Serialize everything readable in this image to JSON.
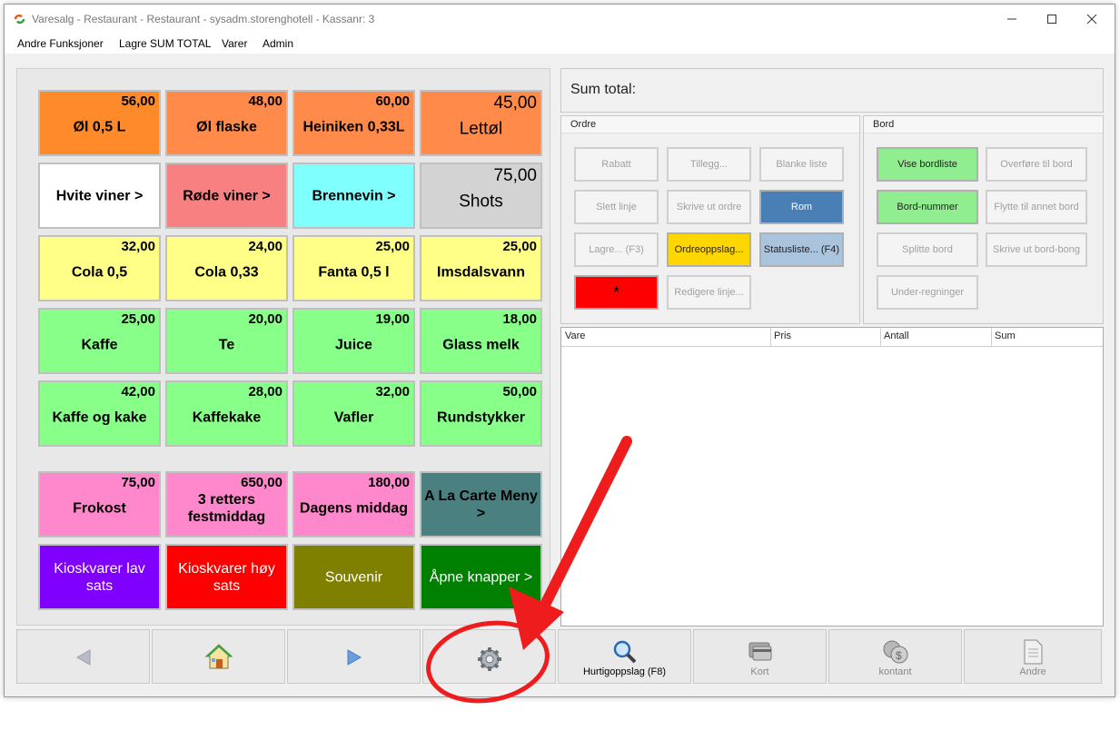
{
  "window": {
    "title": "Varesalg - Restaurant - Restaurant - sysadm.storenghotell -  Kassanr: 3"
  },
  "menu": [
    "Andre Funksjoner",
    "Lagre SUM TOTAL",
    "Varer",
    "Admin"
  ],
  "products": [
    {
      "name": "Øl 0,5 L",
      "price": "56,00",
      "bg": "#ff8a2a"
    },
    {
      "name": "Øl flaske",
      "price": "48,00",
      "bg": "#ff8a4a"
    },
    {
      "name": "Heiniken 0,33L",
      "price": "60,00",
      "bg": "#ff8a4a"
    },
    {
      "name": "Lettøl",
      "price": "45,00",
      "bg": "#ff8a4a"
    },
    {
      "name": "Hvite viner >",
      "price": "",
      "bg": "#ffffff"
    },
    {
      "name": "Røde viner >",
      "price": "",
      "bg": "#f98080"
    },
    {
      "name": "Brennevin >",
      "price": "",
      "bg": "#80ffff"
    },
    {
      "name": "Shots",
      "price": "75,00",
      "bg": "#d3d3d3"
    },
    {
      "name": "Cola 0,5",
      "price": "32,00",
      "bg": "#ffff88"
    },
    {
      "name": "Cola 0,33",
      "price": "24,00",
      "bg": "#ffff88"
    },
    {
      "name": "Fanta 0,5 l",
      "price": "25,00",
      "bg": "#ffff88"
    },
    {
      "name": "Imsdalsvann",
      "price": "25,00",
      "bg": "#ffff88"
    },
    {
      "name": "Kaffe",
      "price": "25,00",
      "bg": "#88ff88"
    },
    {
      "name": "Te",
      "price": "20,00",
      "bg": "#88ff88"
    },
    {
      "name": "Juice",
      "price": "19,00",
      "bg": "#88ff88"
    },
    {
      "name": "Glass melk",
      "price": "18,00",
      "bg": "#88ff88"
    },
    {
      "name": "Kaffe og kake",
      "price": "42,00",
      "bg": "#88ff88"
    },
    {
      "name": "Kaffekake",
      "price": "28,00",
      "bg": "#88ff88"
    },
    {
      "name": "Vafler",
      "price": "32,00",
      "bg": "#88ff88"
    },
    {
      "name": "Rundstykker",
      "price": "50,00",
      "bg": "#88ff88"
    },
    {
      "name": "Frokost",
      "price": "75,00",
      "bg": "#ff88cc"
    },
    {
      "name": "3 retters festmiddag",
      "price": "650,00",
      "bg": "#ff88cc"
    },
    {
      "name": "Dagens middag",
      "price": "180,00",
      "bg": "#ff88cc"
    },
    {
      "name": "A La Carte Meny >",
      "price": "",
      "bg": "#4a8080"
    },
    {
      "name": "Kioskvarer lav sats",
      "price": "",
      "bg": "#8000ff"
    },
    {
      "name": "Kioskvarer høy sats",
      "price": "",
      "bg": "#ff0000"
    },
    {
      "name": "Souvenir",
      "price": "",
      "bg": "#808000"
    },
    {
      "name": "Åpne knapper >",
      "price": "",
      "bg": "#008000"
    }
  ],
  "sum": {
    "label": "Sum total:"
  },
  "ordre": {
    "label": "Ordre",
    "buttons": [
      "Rabatt",
      "Tillegg...",
      "Blanke liste",
      "Slett linje",
      "Skrive ut ordre",
      "Rom",
      "Lagre... (F3)",
      "Ordreoppslag...",
      "Statusliste... (F4)",
      "*",
      "Redigere linje..."
    ]
  },
  "bord": {
    "label": "Bord",
    "buttons": [
      "Vise bordliste",
      "Overføre til bord",
      "Bord-nummer",
      "Flytte til annet bord",
      "Splitte bord",
      "Skrive ut bord-bong",
      "Under-regninger"
    ]
  },
  "grid": {
    "columns": [
      "Vare",
      "Pris",
      "Antall",
      "Sum"
    ]
  },
  "bottom": {
    "buttons": [
      "",
      "",
      "",
      "",
      "Hurtigoppslag (F8)",
      "Kort",
      "kontant",
      "Andre"
    ]
  },
  "icons": [
    "app-logo-icon",
    "minimize-icon",
    "maximize-icon",
    "close-icon",
    "arrow-left-icon",
    "home-icon",
    "arrow-right-icon",
    "gear-icon",
    "magnifier-icon",
    "card-icon",
    "coins-icon",
    "document-icon"
  ],
  "colors": {
    "red_annotation": "#ee1c1c",
    "rom_button": "#4a7fb5",
    "status_button": "#aac4dd",
    "green_button": "#90ee90",
    "yellow_button": "#ffd700"
  }
}
